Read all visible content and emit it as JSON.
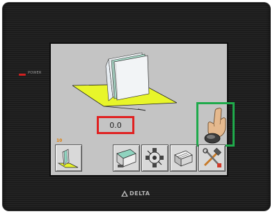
{
  "bezel": {
    "power_label": "POWER",
    "brand": "DELTA"
  },
  "screen": {
    "value_display": "0.0",
    "small_counter": "10",
    "buttons": [
      {
        "name": "book-stand-icon"
      },
      {
        "name": "scanner-icon"
      },
      {
        "name": "machine-part-icon"
      },
      {
        "name": "cutter-icon"
      },
      {
        "name": "tools-icon"
      }
    ]
  },
  "colors": {
    "screen_bg": "#c4c4c4",
    "highlight_red": "#e02020",
    "highlight_green": "#1faa4b",
    "plate_yellow": "#e8f52a"
  }
}
